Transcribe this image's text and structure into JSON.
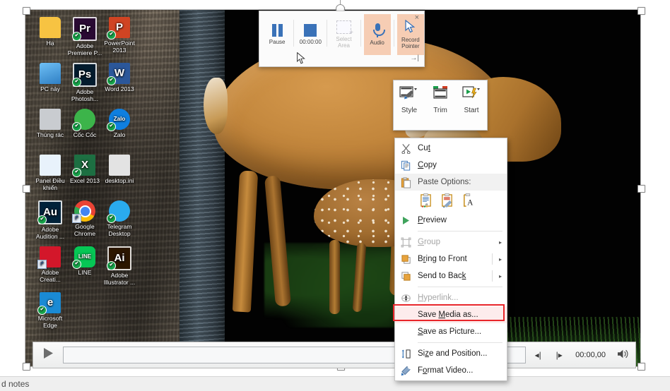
{
  "app": {
    "title": "PowerPoint 2013 slide editor — video object selected",
    "notes_text": "d notes"
  },
  "desktop_icons": [
    {
      "label": "Hạ",
      "icon": "folder-icon",
      "glyph": "",
      "bg": "#f7c342",
      "badge": "none"
    },
    {
      "label": "Adobe Premiere P...",
      "icon": "adobe-premiere-icon",
      "glyph": "Pr",
      "bg": "#2a0a33",
      "badge": "check"
    },
    {
      "label": "PowerPoint 2013",
      "icon": "powerpoint-icon",
      "glyph": "P",
      "bg": "#d04423",
      "badge": "check"
    },
    {
      "label": "PC này",
      "icon": "this-pc-icon",
      "glyph": "",
      "bg": "#3a8fd4",
      "badge": "none"
    },
    {
      "label": "Adobe Photosh...",
      "icon": "adobe-photoshop-icon",
      "glyph": "Ps",
      "bg": "#031c2e",
      "badge": "check"
    },
    {
      "label": "Word 2013",
      "icon": "word-icon",
      "glyph": "W",
      "bg": "#2b579a",
      "badge": "check"
    },
    {
      "label": "Thùng rác",
      "icon": "recycle-bin-icon",
      "glyph": "",
      "bg": "#c9ccd0",
      "badge": "none"
    },
    {
      "label": "Cốc Cốc",
      "icon": "coccoc-browser-icon",
      "glyph": "",
      "bg": "#3cb44a",
      "badge": "check"
    },
    {
      "label": "Zalo",
      "icon": "zalo-icon",
      "glyph": "Zalo",
      "bg": "#0f7fe0",
      "badge": "check"
    },
    {
      "label": "Panel Điều khiển",
      "icon": "control-panel-icon",
      "glyph": "",
      "bg": "#e8f2fb",
      "badge": "none"
    },
    {
      "label": "Excel 2013",
      "icon": "excel-icon",
      "glyph": "X",
      "bg": "#1d6f42",
      "badge": "check"
    },
    {
      "label": "desktop.ini",
      "icon": "ini-file-icon",
      "glyph": "",
      "bg": "#e3e3e3",
      "badge": "none"
    },
    {
      "label": "Adobe Audition ...",
      "icon": "adobe-audition-icon",
      "glyph": "Au",
      "bg": "#00223a",
      "badge": "check"
    },
    {
      "label": "Google Chrome",
      "icon": "google-chrome-icon",
      "glyph": "",
      "bg": "#ffffff",
      "badge": "shortcut"
    },
    {
      "label": "Telegram Desktop",
      "icon": "telegram-icon",
      "glyph": "",
      "bg": "#2aabee",
      "badge": "check"
    },
    {
      "label": "Adobe Creati...",
      "icon": "adobe-creative-cloud-icon",
      "glyph": "",
      "bg": "#d3172a",
      "badge": "shortcut"
    },
    {
      "label": "LINE",
      "icon": "line-messenger-icon",
      "glyph": "LINE",
      "bg": "#06c755",
      "badge": "check"
    },
    {
      "label": "Adobe Illustrator ...",
      "icon": "adobe-illustrator-icon",
      "glyph": "Ai",
      "bg": "#2b1600",
      "badge": "check"
    },
    {
      "label": "Microsoft Edge",
      "icon": "microsoft-edge-icon",
      "glyph": "e",
      "bg": "#1a8ad4",
      "badge": "check"
    }
  ],
  "recorder_toolbar": {
    "buttons": [
      {
        "label": "Pause",
        "icon": "pause-icon",
        "active": false
      },
      {
        "label": "00:00:00",
        "icon": "stop-icon",
        "active": false
      },
      {
        "label": "Select Area",
        "icon": "select-area-icon",
        "active": false,
        "disabled": true
      },
      {
        "label": "Audio",
        "icon": "microphone-icon",
        "active": true
      },
      {
        "label": "Record Pointer",
        "icon": "pointer-icon",
        "active": true
      }
    ],
    "close_label": "×",
    "pin_label": "→|"
  },
  "video_tools_toolbar": {
    "buttons": [
      {
        "label": "Style",
        "icon": "video-style-icon"
      },
      {
        "label": "Trim",
        "icon": "trim-video-icon"
      },
      {
        "label": "Start",
        "icon": "video-start-icon"
      }
    ]
  },
  "context_menu": {
    "items": [
      {
        "label": "Cut",
        "icon": "scissors-icon",
        "type": "item",
        "disabled": false,
        "underline": "t"
      },
      {
        "label": "Copy",
        "icon": "copy-icon",
        "type": "item",
        "disabled": false,
        "underline": "C"
      },
      {
        "label": "Paste Options:",
        "icon": "paste-icon",
        "type": "header",
        "disabled": false
      },
      {
        "label": "",
        "icon": "paste-options-row",
        "type": "paste-row",
        "disabled": false
      },
      {
        "label": "Preview",
        "icon": "play-triangle-icon",
        "type": "item",
        "disabled": false,
        "underline": "P"
      },
      {
        "label": "Group",
        "icon": "group-icon",
        "type": "submenu",
        "disabled": true,
        "underline": "G"
      },
      {
        "label": "Bring to Front",
        "icon": "bring-to-front-icon",
        "type": "submenu",
        "disabled": false,
        "underline": "r"
      },
      {
        "label": "Send to Back",
        "icon": "send-to-back-icon",
        "type": "submenu",
        "disabled": false,
        "underline": "k"
      },
      {
        "label": "Hyperlink...",
        "icon": "hyperlink-icon",
        "type": "item",
        "disabled": true,
        "underline": "H"
      },
      {
        "label": "Save Media as...",
        "icon": "none",
        "type": "item",
        "disabled": false,
        "highlighted": true,
        "underline": "M"
      },
      {
        "label": "Save as Picture...",
        "icon": "none",
        "type": "item",
        "disabled": false,
        "underline": "S"
      },
      {
        "label": "Size and Position...",
        "icon": "size-position-icon",
        "type": "item",
        "disabled": false,
        "underline": "z"
      },
      {
        "label": "Format Video...",
        "icon": "format-video-icon",
        "type": "item",
        "disabled": false,
        "underline": "o"
      }
    ],
    "paste_options": [
      {
        "icon": "paste-keep-source-formatting-icon"
      },
      {
        "icon": "paste-picture-icon"
      },
      {
        "icon": "paste-keep-text-only-icon"
      }
    ],
    "highlight_color": "#e8252a"
  },
  "media_bar": {
    "play_label": "▶",
    "prev_frame_label": "◂|",
    "next_frame_label": "|▸",
    "time": "00:00,00",
    "volume_label": "volume-icon",
    "progress_percent": 0
  },
  "colors": {
    "accent_orange": "#f6cdb4",
    "recorder_blue": "#3a72b8",
    "highlight_red": "#e8252a",
    "menu_bg": "#ffffff",
    "highlight_row_bg": "#fdecec"
  }
}
